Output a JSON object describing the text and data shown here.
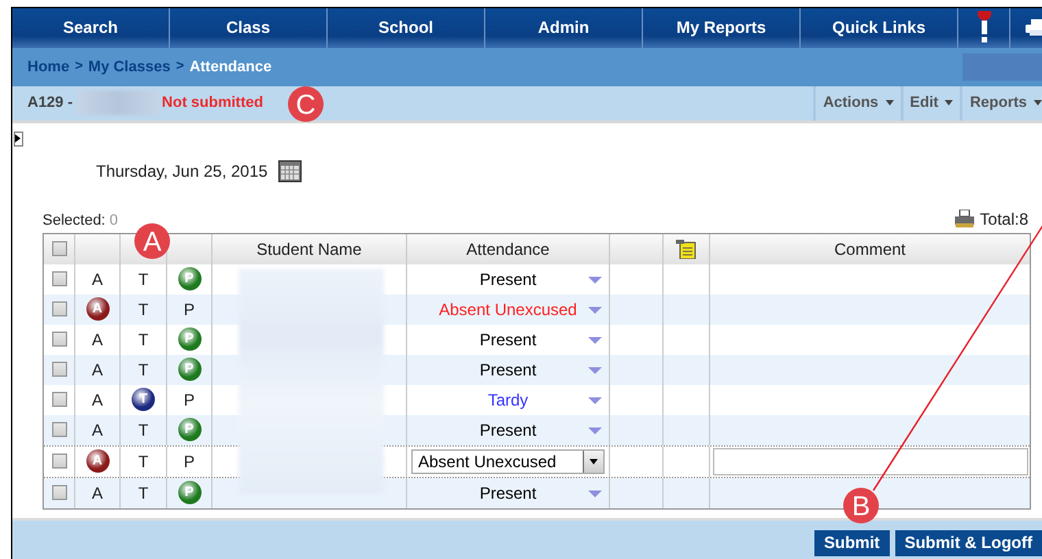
{
  "nav": [
    {
      "label": "Search"
    },
    {
      "label": "Class"
    },
    {
      "label": "School"
    },
    {
      "label": "Admin"
    },
    {
      "label": "My Reports"
    },
    {
      "label": "Quick Links"
    }
  ],
  "breadcrumb": [
    {
      "label": "Home",
      "kind": "link"
    },
    {
      "label": ">",
      "kind": "sep"
    },
    {
      "label": "My Classes",
      "kind": "link"
    },
    {
      "label": ">",
      "kind": "sep"
    },
    {
      "label": "Attendance",
      "kind": "current"
    }
  ],
  "class_bar": {
    "code": "A129 -",
    "status": "Not submitted",
    "menus": [
      "Actions",
      "Edit",
      "Reports"
    ]
  },
  "date": "Thursday, Jun 25, 2015",
  "selected": {
    "label": "Selected:",
    "count": "0"
  },
  "total": "Total:8",
  "table": {
    "header_checked": false,
    "columns": [
      {
        "kind": "blank"
      },
      {
        "kind": "blank"
      },
      {
        "kind": "blank"
      },
      {
        "kind": "text",
        "label": "Student Name"
      },
      {
        "kind": "text",
        "label": "Attendance"
      },
      {
        "kind": "blank"
      },
      {
        "kind": "note"
      },
      {
        "kind": "text",
        "label": "Comment"
      }
    ],
    "rows": [
      {
        "kind": "view",
        "checked": false,
        "marks": [
          {
            "text": "A",
            "badge": false
          },
          {
            "text": "T",
            "badge": false
          },
          {
            "text": "P",
            "badge": true
          }
        ],
        "attendance": {
          "text": "Present",
          "color": "#000000"
        }
      },
      {
        "kind": "view",
        "checked": false,
        "marks": [
          {
            "text": "A",
            "badge": true
          },
          {
            "text": "T",
            "badge": false
          },
          {
            "text": "P",
            "badge": false
          }
        ],
        "attendance": {
          "text": "Absent Unexcused",
          "color": "#ff2020"
        }
      },
      {
        "kind": "view",
        "checked": false,
        "marks": [
          {
            "text": "A",
            "badge": false
          },
          {
            "text": "T",
            "badge": false
          },
          {
            "text": "P",
            "badge": true
          }
        ],
        "attendance": {
          "text": "Present",
          "color": "#000000"
        }
      },
      {
        "kind": "view",
        "checked": false,
        "marks": [
          {
            "text": "A",
            "badge": false
          },
          {
            "text": "T",
            "badge": false
          },
          {
            "text": "P",
            "badge": true
          }
        ],
        "attendance": {
          "text": "Present",
          "color": "#000000"
        }
      },
      {
        "kind": "view",
        "checked": false,
        "marks": [
          {
            "text": "A",
            "badge": false
          },
          {
            "text": "T",
            "badge": true
          },
          {
            "text": "P",
            "badge": false
          }
        ],
        "attendance": {
          "text": "Tardy",
          "color": "#3333ff"
        }
      },
      {
        "kind": "view",
        "checked": false,
        "marks": [
          {
            "text": "A",
            "badge": false
          },
          {
            "text": "T",
            "badge": false
          },
          {
            "text": "P",
            "badge": true
          }
        ],
        "attendance": {
          "text": "Present",
          "color": "#000000"
        }
      },
      {
        "kind": "edit",
        "checked": false,
        "marks": [
          {
            "text": "A",
            "badge": true
          },
          {
            "text": "T",
            "badge": false
          },
          {
            "text": "P",
            "badge": false
          }
        ],
        "attendance": {
          "text": "Absent Unexcused",
          "color": "#000000"
        }
      },
      {
        "kind": "view",
        "checked": false,
        "marks": [
          {
            "text": "A",
            "badge": false
          },
          {
            "text": "T",
            "badge": false
          },
          {
            "text": "P",
            "badge": true
          }
        ],
        "attendance": {
          "text": "Present",
          "color": "#000000"
        }
      }
    ]
  },
  "buttons": [
    "Submit",
    "Submit & Logoff"
  ],
  "callouts": [
    "C",
    "A",
    "B"
  ]
}
